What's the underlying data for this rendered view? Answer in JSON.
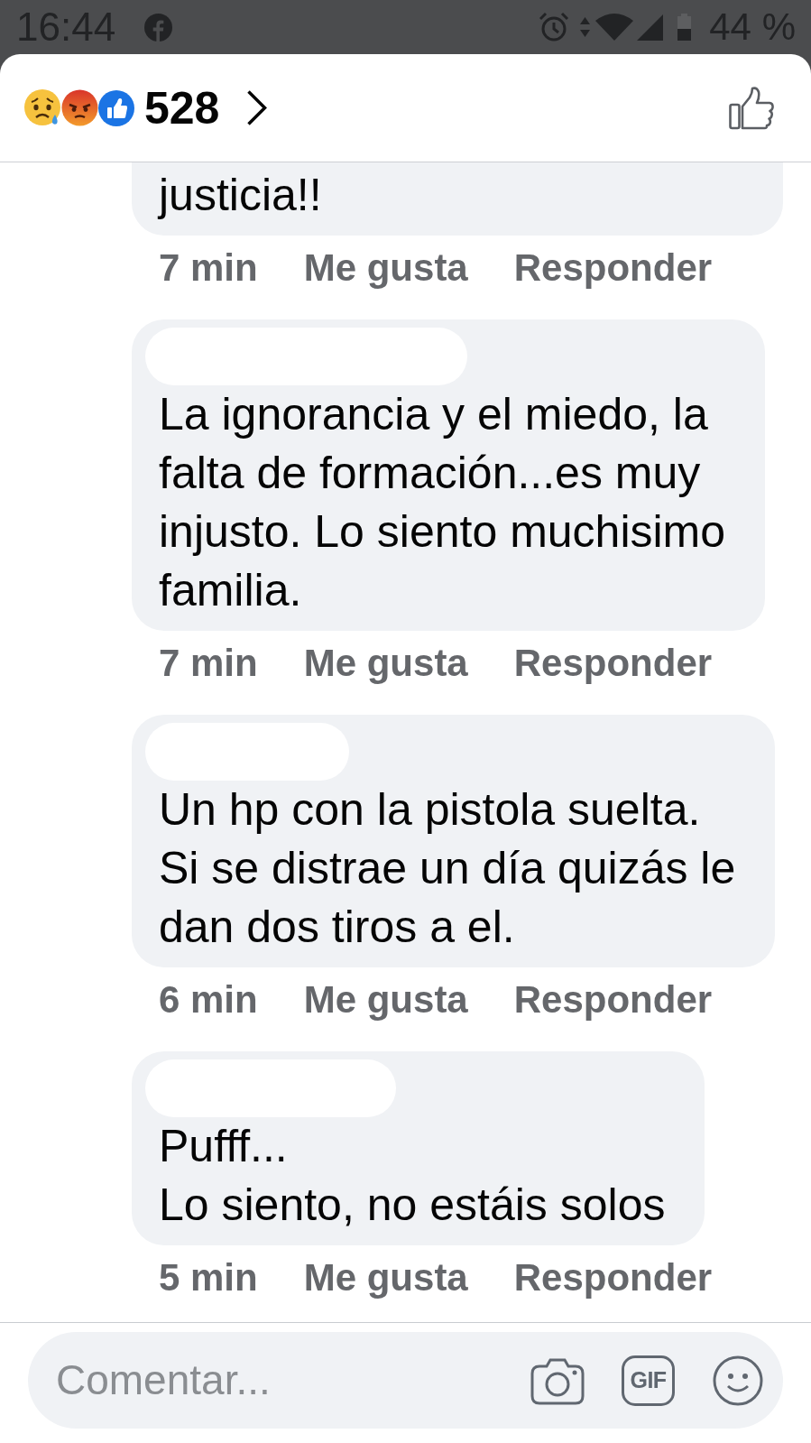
{
  "status_bar": {
    "time": "16:44",
    "battery": "44 %"
  },
  "reactions": {
    "count": "528"
  },
  "comments": [
    {
      "clipped": true,
      "text": "justicia!!",
      "time": "7 min",
      "like": "Me gusta",
      "reply": "Responder"
    },
    {
      "clipped": false,
      "text": "La ignorancia y el miedo, la\nfalta de formación...es muy\ninjusto. Lo siento muchisimo\nfamilia.",
      "time": "7 min",
      "like": "Me gusta",
      "reply": "Responder"
    },
    {
      "clipped": false,
      "text": "Un hp con la pistola suelta.\nSi se distrae un día quizás le\ndan dos tiros a el.",
      "time": "6 min",
      "like": "Me gusta",
      "reply": "Responder"
    },
    {
      "clipped": false,
      "text": "Pufff...\nLo siento, no estáis solos",
      "time": "5 min",
      "like": "Me gusta",
      "reply": "Responder"
    }
  ],
  "composer": {
    "placeholder": "Comentar...",
    "gif_label": "GIF"
  }
}
